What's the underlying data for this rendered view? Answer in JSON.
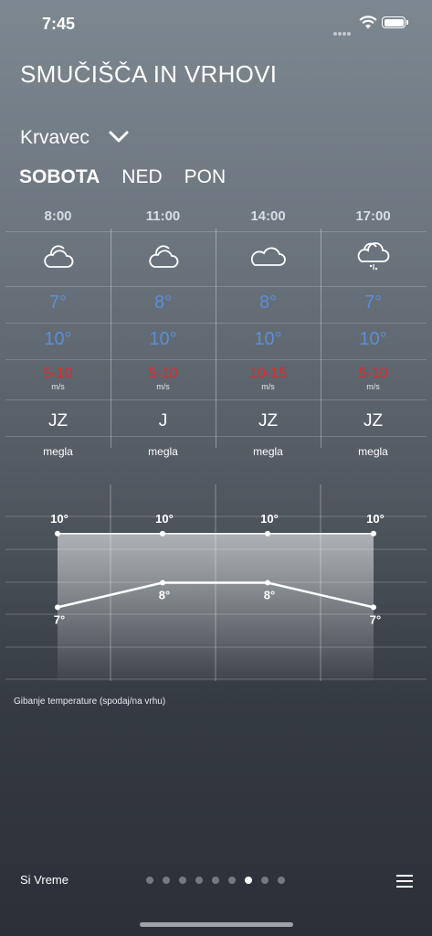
{
  "status": {
    "time": "7:45"
  },
  "header": {
    "title": "SMUČIŠČA IN VRHOVI",
    "location": "Krvavec"
  },
  "days": [
    {
      "label": "SOBOTA",
      "active": true
    },
    {
      "label": "NED",
      "active": false
    },
    {
      "label": "PON",
      "active": false
    }
  ],
  "forecast": [
    {
      "time": "8:00",
      "icon": "cloud-sun-icon",
      "temp_low": "7°",
      "temp_high": "10°",
      "wind": "5-10",
      "wind_unit": "m/s",
      "direction": "JZ",
      "condition": "megla"
    },
    {
      "time": "11:00",
      "icon": "cloud-sun-icon",
      "temp_low": "8°",
      "temp_high": "10°",
      "wind": "5-10",
      "wind_unit": "m/s",
      "direction": "J",
      "condition": "megla"
    },
    {
      "time": "14:00",
      "icon": "cloud-icon",
      "temp_low": "8°",
      "temp_high": "10°",
      "wind": "10-15",
      "wind_unit": "m/s",
      "direction": "JZ",
      "condition": "megla"
    },
    {
      "time": "17:00",
      "icon": "cloud-rain-icon",
      "temp_low": "7°",
      "temp_high": "10°",
      "wind": "5-10",
      "wind_unit": "m/s",
      "direction": "JZ",
      "condition": "megla"
    }
  ],
  "chart_data": {
    "type": "line",
    "x": [
      "8:00",
      "11:00",
      "14:00",
      "17:00"
    ],
    "series": [
      {
        "values": [
          10,
          10,
          10,
          10
        ]
      },
      {
        "values": [
          7,
          8,
          8,
          7
        ]
      }
    ],
    "point_labels_top": [
      "10°",
      "10°",
      "10°",
      "10°"
    ],
    "point_labels_bottom": [
      "7°",
      "8°",
      "8°",
      "7°"
    ],
    "ylim": [
      4,
      12
    ],
    "grid": true
  },
  "chart_caption": "Gibanje temperature (spodaj/na vrhu)",
  "footer": {
    "brand": "Si Vreme",
    "page_count": 9,
    "active_page": 6
  },
  "colors": {
    "temp": "#5b8ed8",
    "wind": "#e02b2b"
  }
}
